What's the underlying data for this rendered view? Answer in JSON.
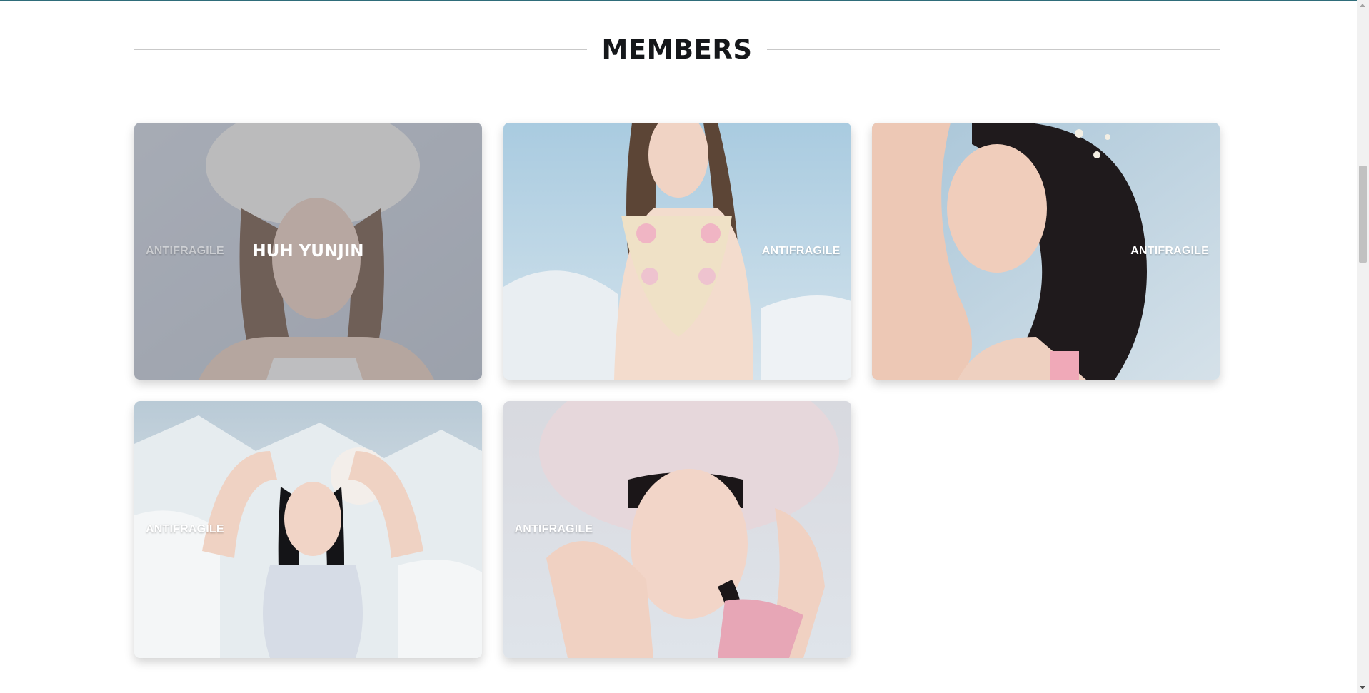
{
  "section": {
    "title": "MEMBERS"
  },
  "members": [
    {
      "album": "ANTIFRAGILE",
      "name": "HUH YUNJIN",
      "tag_side": "left",
      "hovered": true
    },
    {
      "album": "ANTIFRAGILE",
      "tag_side": "right",
      "hovered": false
    },
    {
      "album": "ANTIFRAGILE",
      "tag_side": "right",
      "hovered": false
    },
    {
      "album": "ANTIFRAGILE",
      "tag_side": "left",
      "hovered": false
    },
    {
      "album": "ANTIFRAGILE",
      "tag_side": "left",
      "hovered": false
    }
  ],
  "colors": {
    "heading": "#15171a",
    "tag_text": "#ffffff",
    "divider": "#c9c9c9"
  }
}
